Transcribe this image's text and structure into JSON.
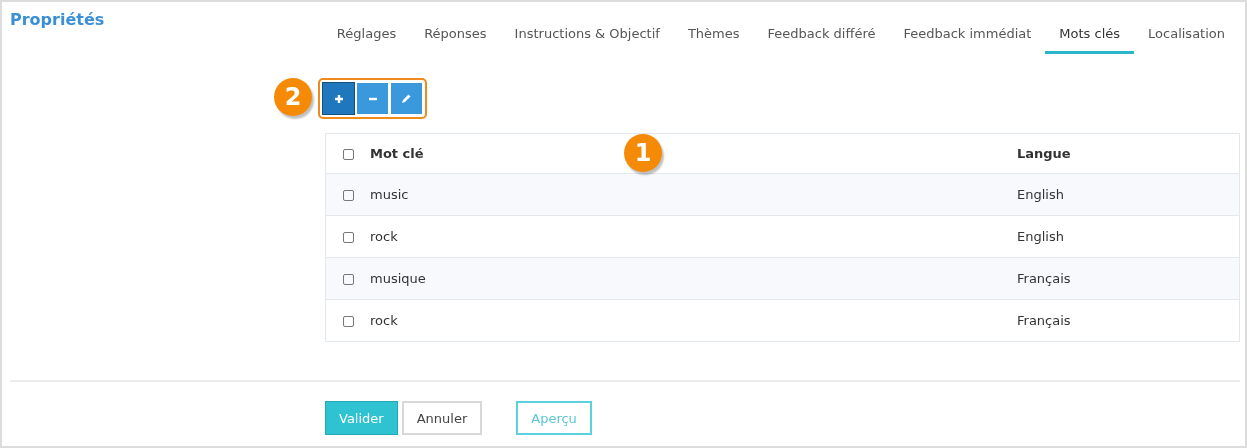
{
  "title": "Propriétés",
  "tabs": [
    {
      "label": "Réglages",
      "selected": false
    },
    {
      "label": "Réponses",
      "selected": false
    },
    {
      "label": "Instructions & Objectif",
      "selected": false
    },
    {
      "label": "Thèmes",
      "selected": false
    },
    {
      "label": "Feedback différé",
      "selected": false
    },
    {
      "label": "Feedback immédiat",
      "selected": false
    },
    {
      "label": "Mots clés",
      "selected": true
    },
    {
      "label": "Localisation",
      "selected": false
    }
  ],
  "toolbar": {
    "callout": "2",
    "buttons": [
      {
        "kind": "add",
        "selected": true
      },
      {
        "kind": "remove",
        "selected": false
      },
      {
        "kind": "edit",
        "selected": false
      }
    ]
  },
  "table": {
    "callout": "1",
    "columns": [
      "Mot clé",
      "Langue"
    ],
    "all_checked": false,
    "rows": [
      {
        "checked": false,
        "cells": [
          "music",
          "English"
        ]
      },
      {
        "checked": false,
        "cells": [
          "rock",
          "English"
        ]
      },
      {
        "checked": false,
        "cells": [
          "musique",
          "Français"
        ]
      },
      {
        "checked": false,
        "cells": [
          "rock",
          "Français"
        ]
      }
    ]
  },
  "buttons": [
    {
      "kind": "primary",
      "label": "Valider"
    },
    {
      "kind": "default",
      "label": "Annuler"
    },
    {
      "kind": "outline",
      "label": "Aperçu"
    }
  ]
}
